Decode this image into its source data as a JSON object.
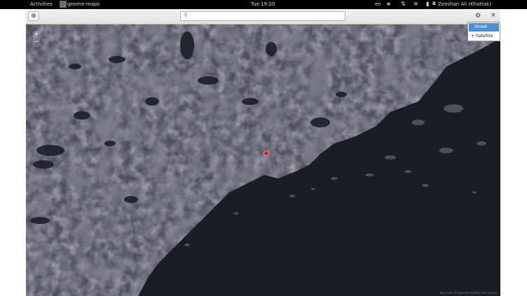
{
  "topbar": {
    "activities": "Activities",
    "app_name": "gnome-maps",
    "clock": "Tue 19:20",
    "lang": "en",
    "user": "Zeeshan Ali (Khattak)"
  },
  "header": {
    "search_placeholder": ""
  },
  "map": {
    "zoom_in": "+",
    "zoom_out": "−",
    "attribution": "Map data © OpenStreetMap contributors"
  },
  "map_type_menu": {
    "items": [
      {
        "label": "Street",
        "selected": true
      },
      {
        "label": "Satellite",
        "selected": false,
        "radio": "+"
      }
    ]
  },
  "colors": {
    "accent": "#4a90d9",
    "marker": "#e01b1b",
    "sea": "#1a1d26"
  }
}
